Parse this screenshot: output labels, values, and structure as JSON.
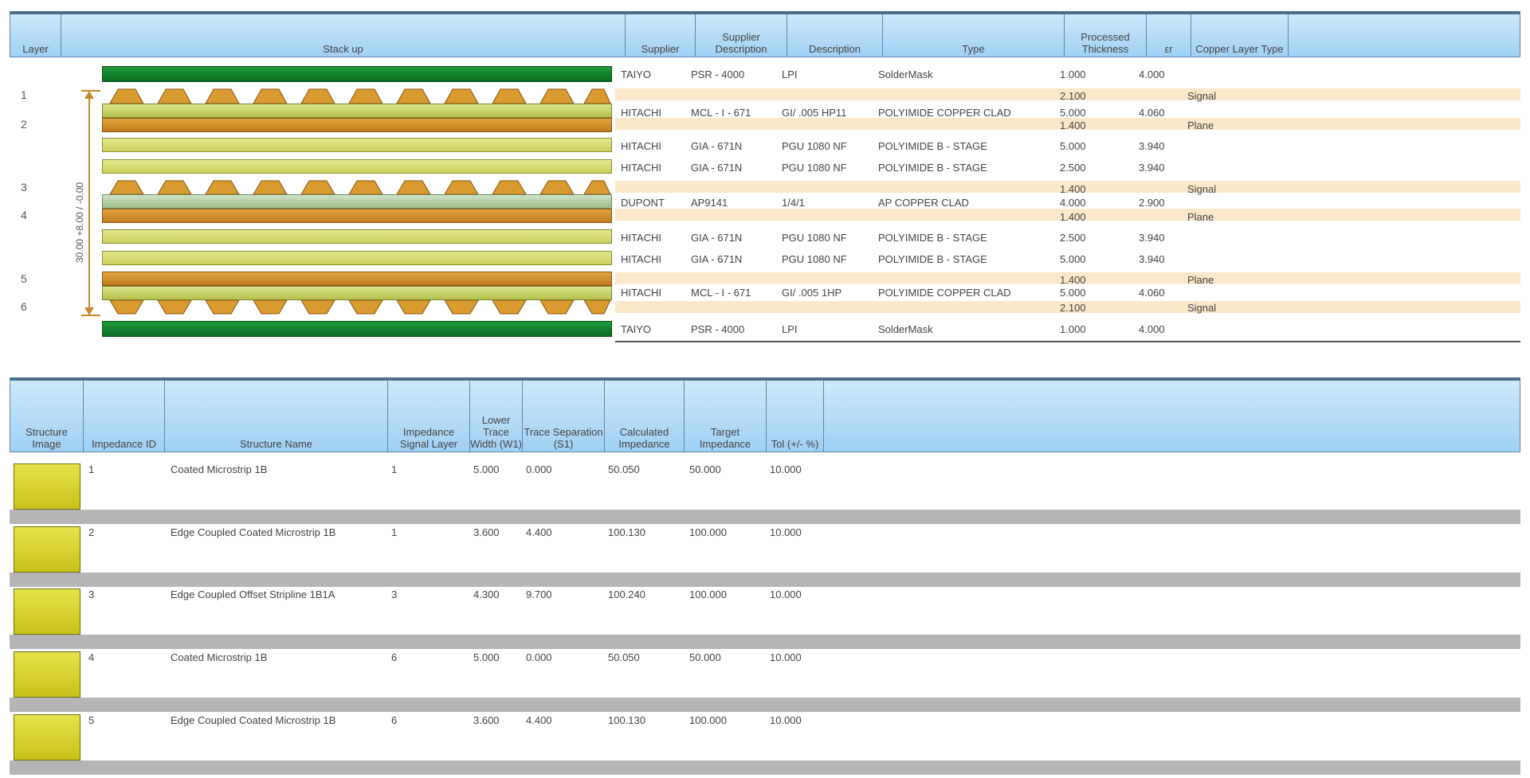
{
  "stackup_header": [
    "Layer",
    "Stack up",
    "Supplier",
    "Supplier Description",
    "Description",
    "Type",
    "Processed Thickness",
    "εr",
    "Copper Layer Type"
  ],
  "layer_labels": [
    "1",
    "2",
    "3",
    "4",
    "5",
    "6"
  ],
  "dimension_label": "30.00 +8.00 / -0.00",
  "stackup_rows": [
    {
      "supplier": "TAIYO",
      "sdesc": "PSR - 4000",
      "desc": "LPI",
      "type": "SolderMask",
      "thk": "1.000",
      "er": "4.000",
      "cu": ""
    },
    {
      "supplier": "",
      "sdesc": "",
      "desc": "",
      "type": "",
      "thk": "2.100",
      "er": "",
      "cu": "Signal"
    },
    {
      "supplier": "HITACHI",
      "sdesc": "MCL - I - 671",
      "desc": "GI/ .005 HP11",
      "type": "POLYIMIDE COPPER CLAD",
      "thk": "5.000",
      "er": "4.060",
      "cu": ""
    },
    {
      "supplier": "",
      "sdesc": "",
      "desc": "",
      "type": "",
      "thk": "1.400",
      "er": "",
      "cu": "Plane"
    },
    {
      "supplier": "HITACHI",
      "sdesc": "GIA - 671N",
      "desc": "PGU 1080 NF",
      "type": "POLYIMIDE B - STAGE",
      "thk": "5.000",
      "er": "3.940",
      "cu": ""
    },
    {
      "supplier": "HITACHI",
      "sdesc": "GIA - 671N",
      "desc": "PGU 1080 NF",
      "type": "POLYIMIDE B - STAGE",
      "thk": "2.500",
      "er": "3.940",
      "cu": ""
    },
    {
      "supplier": "",
      "sdesc": "",
      "desc": "",
      "type": "",
      "thk": "1.400",
      "er": "",
      "cu": "Signal"
    },
    {
      "supplier": "DUPONT",
      "sdesc": "AP9141",
      "desc": "1/4/1",
      "type": "AP COPPER CLAD",
      "thk": "4.000",
      "er": "2.900",
      "cu": ""
    },
    {
      "supplier": "",
      "sdesc": "",
      "desc": "",
      "type": "",
      "thk": "1.400",
      "er": "",
      "cu": "Plane"
    },
    {
      "supplier": "HITACHI",
      "sdesc": "GIA - 671N",
      "desc": "PGU 1080 NF",
      "type": "POLYIMIDE B - STAGE",
      "thk": "2.500",
      "er": "3.940",
      "cu": ""
    },
    {
      "supplier": "HITACHI",
      "sdesc": "GIA - 671N",
      "desc": "PGU 1080 NF",
      "type": "POLYIMIDE B - STAGE",
      "thk": "5.000",
      "er": "3.940",
      "cu": ""
    },
    {
      "supplier": "",
      "sdesc": "",
      "desc": "",
      "type": "",
      "thk": "1.400",
      "er": "",
      "cu": "Plane"
    },
    {
      "supplier": "HITACHI",
      "sdesc": "MCL - I - 671",
      "desc": "GI/ .005 1HP",
      "type": "POLYIMIDE COPPER CLAD",
      "thk": "5.000",
      "er": "4.060",
      "cu": ""
    },
    {
      "supplier": "",
      "sdesc": "",
      "desc": "",
      "type": "",
      "thk": "2.100",
      "er": "",
      "cu": "Signal"
    },
    {
      "supplier": "TAIYO",
      "sdesc": "PSR - 4000",
      "desc": "LPI",
      "type": "SolderMask",
      "thk": "1.000",
      "er": "4.000",
      "cu": ""
    }
  ],
  "impedance_header": [
    "Structure Image",
    "Impedance ID",
    "Structure Name",
    "Impedance Signal Layer",
    "Lower Trace Width (W1)",
    "Trace Separation (S1)",
    "Calculated Impedance",
    "Target Impedance",
    "Tol (+/- %)"
  ],
  "impedance_rows": [
    {
      "id": "1",
      "name": "Coated Microstrip 1B",
      "layer": "1",
      "w1": "5.000",
      "s1": "0.000",
      "calc": "50.050",
      "target": "50.000",
      "tol": "10.000"
    },
    {
      "id": "2",
      "name": "Edge Coupled Coated Microstrip 1B",
      "layer": "1",
      "w1": "3.600",
      "s1": "4.400",
      "calc": "100.130",
      "target": "100.000",
      "tol": "10.000"
    },
    {
      "id": "3",
      "name": "Edge Coupled Offset Stripline 1B1A",
      "layer": "3",
      "w1": "4.300",
      "s1": "9.700",
      "calc": "100.240",
      "target": "100.000",
      "tol": "10.000"
    },
    {
      "id": "4",
      "name": "Coated Microstrip 1B",
      "layer": "6",
      "w1": "5.000",
      "s1": "0.000",
      "calc": "50.050",
      "target": "50.000",
      "tol": "10.000"
    },
    {
      "id": "5",
      "name": "Edge Coupled Coated Microstrip 1B",
      "layer": "6",
      "w1": "3.600",
      "s1": "4.400",
      "calc": "100.130",
      "target": "100.000",
      "tol": "10.000"
    }
  ]
}
